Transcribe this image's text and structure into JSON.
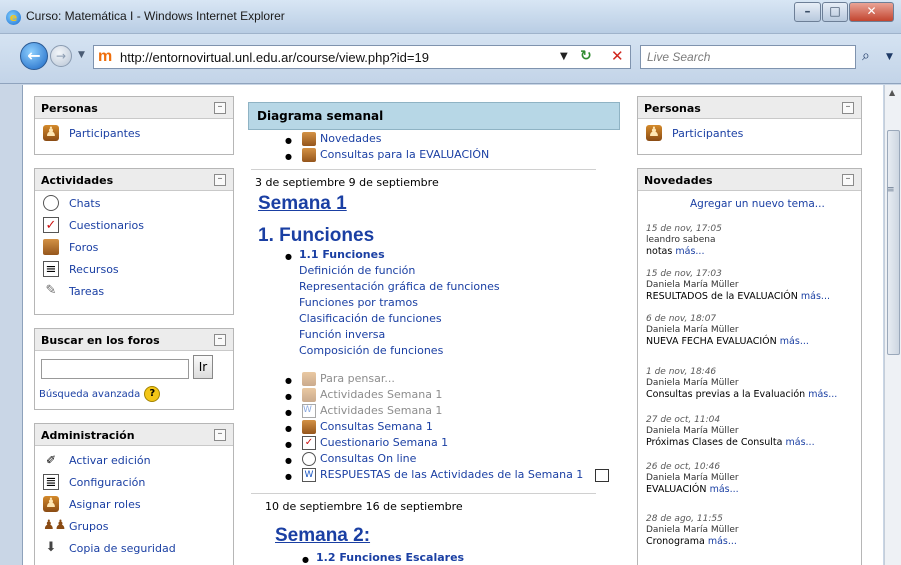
{
  "window": {
    "title": "Curso: Matemática I - Windows Internet Explorer"
  },
  "browser": {
    "url": "http://entornovirtual.unl.edu.ar/course/view.php?id=19",
    "search_placeholder": "Live Search"
  },
  "left": {
    "personas": {
      "title": "Personas",
      "items": [
        "Participantes"
      ]
    },
    "actividades": {
      "title": "Actividades",
      "items": [
        "Chats",
        "Cuestionarios",
        "Foros",
        "Recursos",
        "Tareas"
      ]
    },
    "buscar": {
      "title": "Buscar en los foros",
      "button": "Ir",
      "advanced": "Búsqueda avanzada"
    },
    "admin": {
      "title": "Administración",
      "items": [
        "Activar edición",
        "Configuración",
        "Asignar roles",
        "Grupos",
        "Copia de seguridad"
      ]
    }
  },
  "center": {
    "header": "Diagrama semanal",
    "top_items": [
      "Novedades",
      "Consultas para la EVALUACIÓN"
    ],
    "week1": {
      "dates": "3 de septiembre 9 de septiembre",
      "title": "Semana 1",
      "heading": "1. Funciones",
      "sub": "1.1 Funciones",
      "topics": [
        "Definición de función",
        "Representación gráfica de funciones",
        "Funciones por tramos",
        "Clasificación de funciones",
        "Función inversa",
        "Composición de funciones"
      ],
      "activities": [
        "Para pensar...",
        "Actividades Semana 1",
        "Actividades Semana 1",
        "Consultas Semana 1",
        "Cuestionario Semana 1",
        "Consultas On line",
        "RESPUESTAS de las Actividades de la Semana 1"
      ]
    },
    "week2": {
      "dates": "10 de septiembre 16 de septiembre",
      "title": "Semana 2:",
      "sub": "1.2 Funciones Escalares"
    }
  },
  "right": {
    "personas": {
      "title": "Personas",
      "items": [
        "Participantes"
      ]
    },
    "novedades": {
      "title": "Novedades",
      "add": "Agregar un nuevo tema...",
      "more": "más...",
      "posts": [
        {
          "date": "15 de nov, 17:05",
          "author": "leandro sabena",
          "text": "notas"
        },
        {
          "date": "15 de nov, 17:03",
          "author": "Daniela María Müller",
          "text": "RESULTADOS de la EVALUACIÓN"
        },
        {
          "date": "6 de nov, 18:07",
          "author": "Daniela María Müller",
          "text": "NUEVA FECHA EVALUACIÓN"
        },
        {
          "date": "1 de nov, 18:46",
          "author": "Daniela María Müller",
          "text": "Consultas previas a la Evaluación"
        },
        {
          "date": "27 de oct, 11:04",
          "author": "Daniela María Müller",
          "text": "Próximas Clases de Consulta"
        },
        {
          "date": "26 de oct, 10:46",
          "author": "Daniela María Müller",
          "text": "EVALUACIÓN"
        },
        {
          "date": "28 de ago, 11:55",
          "author": "Daniela María Müller",
          "text": "Cronograma"
        }
      ]
    }
  }
}
